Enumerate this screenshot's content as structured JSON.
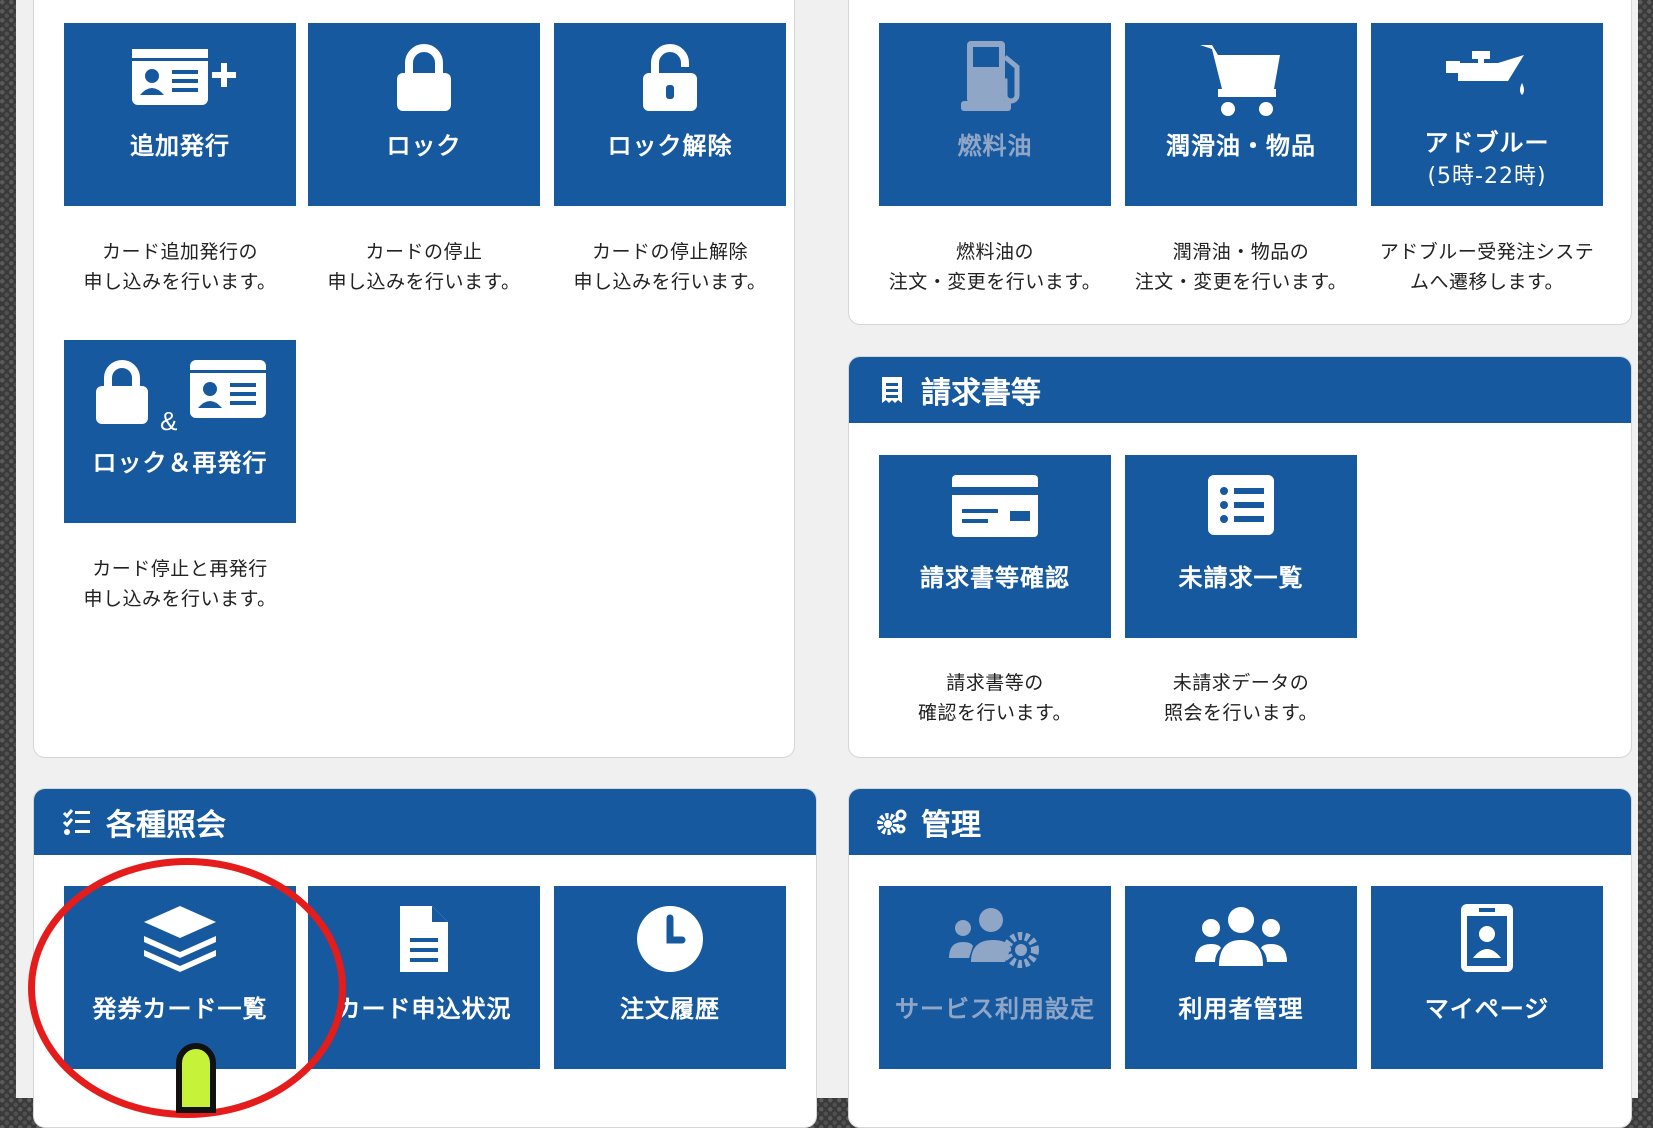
{
  "card_panel": {
    "tiles": [
      {
        "label": "追加発行",
        "icon": "id-card-add-icon",
        "desc1": "カード追加発行の",
        "desc2": "申し込みを行います。"
      },
      {
        "label": "ロック",
        "icon": "lock-icon",
        "desc1": "カードの停止",
        "desc2": "申し込みを行います。"
      },
      {
        "label": "ロック解除",
        "icon": "unlock-icon",
        "desc1": "カードの停止解除",
        "desc2": "申し込みを行います。"
      },
      {
        "label": "ロック＆再発行",
        "icon": "lock-and-id-card-icon",
        "amp": "&",
        "desc1": "カード停止と再発行",
        "desc2": "申し込みを行います。"
      }
    ]
  },
  "order_panel": {
    "tiles": [
      {
        "label": "燃料油",
        "icon": "gas-pump-icon",
        "disabled": true,
        "desc1": "燃料油の",
        "desc2": "注文・変更を行います。"
      },
      {
        "label": "潤滑油・物品",
        "icon": "shopping-cart-icon",
        "desc1": "潤滑油・物品の",
        "desc2": "注文・変更を行います。"
      },
      {
        "label": "アドブルー",
        "label2": "(5時-22時)",
        "icon": "oil-can-icon",
        "desc1": "アドブルー受発注システ",
        "desc2": "ムへ遷移します。"
      }
    ]
  },
  "invoice_panel": {
    "title": "請求書等",
    "icon": "receipt-icon",
    "tiles": [
      {
        "label": "請求書等確認",
        "icon": "invoice-card-icon",
        "desc1": "請求書等の",
        "desc2": "確認を行います。"
      },
      {
        "label": "未請求一覧",
        "icon": "list-icon",
        "desc1": "未請求データの",
        "desc2": "照会を行います。"
      }
    ]
  },
  "inquiry_panel": {
    "title": "各種照会",
    "icon": "checklist-icon",
    "tiles": [
      {
        "label": "発券カード一覧",
        "icon": "layers-icon"
      },
      {
        "label": "カード申込状況",
        "icon": "document-icon"
      },
      {
        "label": "注文履歴",
        "icon": "clock-icon"
      }
    ]
  },
  "admin_panel": {
    "title": "管理",
    "icon": "gears-icon",
    "tiles": [
      {
        "label": "サービス利用設定",
        "icon": "users-gear-icon",
        "disabled": true
      },
      {
        "label": "利用者管理",
        "icon": "users-icon"
      },
      {
        "label": "マイページ",
        "icon": "id-badge-icon"
      }
    ]
  },
  "colors": {
    "tile_blue": "#17599f",
    "disabled_text": "#8fa6c6",
    "annotation_red": "#e41c1c",
    "cursor_green": "#c6f23a"
  }
}
